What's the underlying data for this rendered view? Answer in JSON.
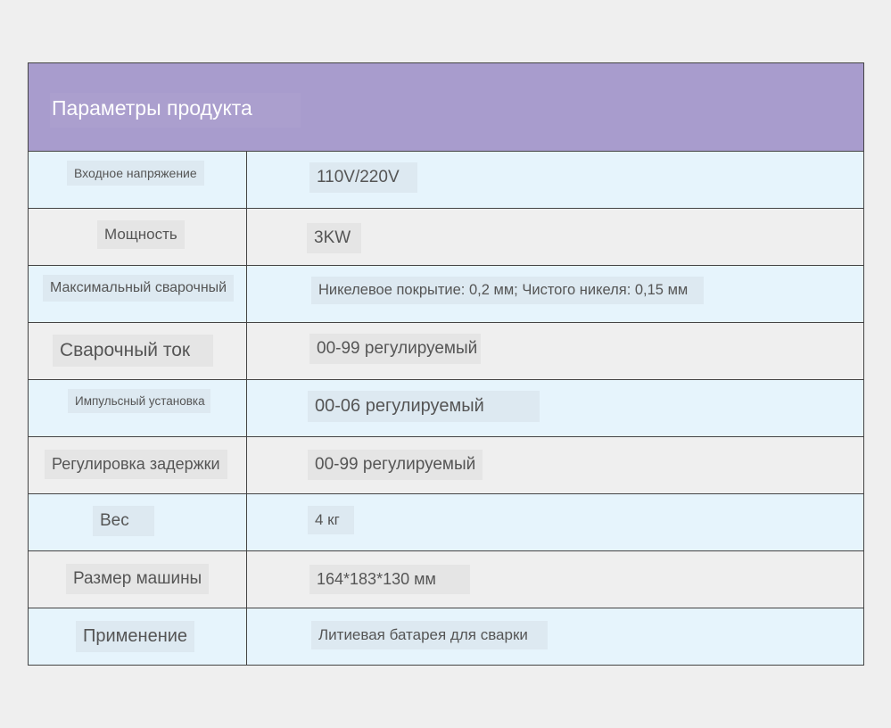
{
  "table": {
    "header_title": "Параметры продукта",
    "rows": [
      {
        "label": "Входное напряжение",
        "value": "110V/220V"
      },
      {
        "label": "Мощность",
        "value": "3KW"
      },
      {
        "label": "Максимальный сварочный",
        "value": "Никелевое покрытие: 0,2 мм; Чистого никеля: 0,15 мм"
      },
      {
        "label": "Сварочный ток",
        "value": "00-99 регулируемый"
      },
      {
        "label": "Импульсный установка",
        "value": "00-06 регулируемый"
      },
      {
        "label": "Регулировка задержки",
        "value": "00-99 регулируемый"
      },
      {
        "label": "Вес",
        "value": "4 кг"
      },
      {
        "label": "Размер машины",
        "value": "164*183*130 мм"
      },
      {
        "label": "Применение",
        "value": "Литиевая батарея для сварки"
      }
    ]
  },
  "colors": {
    "header_bg": "#a89ccd",
    "row_light_blue": "#e6f4fc",
    "row_gray": "#efefef",
    "text": "#555555"
  }
}
